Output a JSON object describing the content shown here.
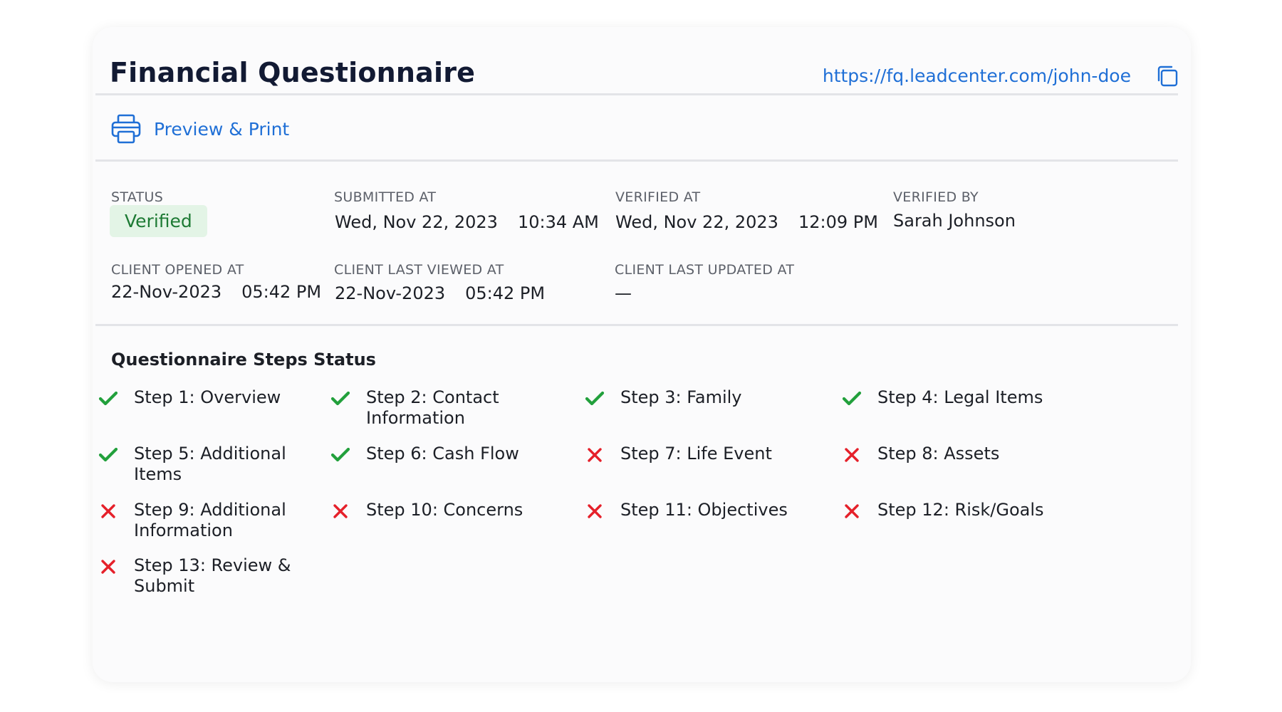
{
  "header": {
    "title": "Financial Questionnaire",
    "url": "https://fq.leadcenter.com/john-doe",
    "copy_icon": "copy-icon"
  },
  "actions": {
    "preview_print_label": "Preview & Print",
    "preview_print_icon": "printer-icon"
  },
  "meta": {
    "status": {
      "label": "STATUS",
      "value": "Verified"
    },
    "submitted_at": {
      "label": "SUBMITTED AT",
      "date": "Wed, Nov 22, 2023",
      "time": "10:34 AM"
    },
    "verified_at": {
      "label": "VERIFIED AT",
      "date": "Wed, Nov 22, 2023",
      "time": "12:09 PM"
    },
    "verified_by": {
      "label": "VERIFIED BY",
      "value": "Sarah Johnson"
    },
    "client_opened_at": {
      "label": "CLIENT OPENED AT",
      "date": "22-Nov-2023",
      "time": "05:42 PM"
    },
    "client_last_viewed_at": {
      "label": "CLIENT LAST VIEWED AT",
      "date": "22-Nov-2023",
      "time": "05:42 PM"
    },
    "client_last_updated_at": {
      "label": "CLIENT LAST UPDATED AT",
      "value": "—"
    }
  },
  "steps_section": {
    "title": "Questionnaire Steps Status",
    "steps": [
      {
        "label": "Step 1: Overview",
        "done": true
      },
      {
        "label": "Step 2: Contact Information",
        "done": true
      },
      {
        "label": "Step 3: Family",
        "done": true
      },
      {
        "label": "Step 4: Legal Items",
        "done": true
      },
      {
        "label": "Step 5: Additional Items",
        "done": true
      },
      {
        "label": "Step 6: Cash Flow",
        "done": true
      },
      {
        "label": "Step 7: Life Event",
        "done": false
      },
      {
        "label": "Step 8: Assets",
        "done": false
      },
      {
        "label": "Step 9: Additional Information",
        "done": false
      },
      {
        "label": "Step 10: Concerns",
        "done": false
      },
      {
        "label": "Step 11: Objectives",
        "done": false
      },
      {
        "label": "Step 12: Risk/Goals",
        "done": false
      },
      {
        "label": "Step 13: Review & Submit",
        "done": false
      }
    ]
  },
  "colors": {
    "accent": "#1f6fd6",
    "success": "#22a03c",
    "error": "#e5202a",
    "badge_bg": "#e3f4e6",
    "badge_text": "#1d7a34"
  }
}
